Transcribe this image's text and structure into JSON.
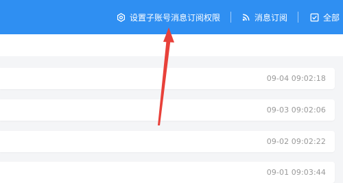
{
  "colors": {
    "topbar": "#2f8ff2",
    "arrow": "#e8413a"
  },
  "toolbar": {
    "subaccount_settings": {
      "icon": "gear-icon",
      "label": "设置子账号消息订阅权限"
    },
    "subscribe": {
      "icon": "rss-icon",
      "label": "消息订阅"
    },
    "select_all": {
      "icon": "checkbox-icon",
      "label": "全部"
    }
  },
  "messages": [
    {
      "time": "09-04 09:02:18"
    },
    {
      "time": "09-03 09:02:06"
    },
    {
      "time": "09-02 09:02:22"
    },
    {
      "time": "09-01 09:03:44"
    }
  ]
}
